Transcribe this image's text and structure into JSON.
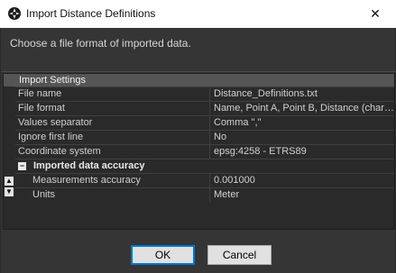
{
  "window": {
    "title": "Import Distance Definitions",
    "close_glyph": "✕"
  },
  "prompt": "Choose a file format of imported data.",
  "settings": {
    "header": "Import Settings",
    "rows": [
      {
        "key": "File name",
        "value": "Distance_Definitions.txt"
      },
      {
        "key": "File format",
        "value": "Name, Point A, Point B, Distance (character..."
      },
      {
        "key": "Values separator",
        "value": "Comma \",\""
      },
      {
        "key": "Ignore first line",
        "value": "No"
      },
      {
        "key": "Coordinate system",
        "value": "epsg:4258 - ETRS89"
      }
    ],
    "group": {
      "toggle": "−",
      "label": "Imported data accuracy",
      "rows": [
        {
          "key": "Measurements accuracy",
          "value": "0.001000"
        },
        {
          "key": "Units",
          "value": "Meter"
        }
      ]
    }
  },
  "side_buttons": {
    "up": "▲",
    "down": "▼"
  },
  "buttons": {
    "ok": "OK",
    "cancel": "Cancel"
  }
}
